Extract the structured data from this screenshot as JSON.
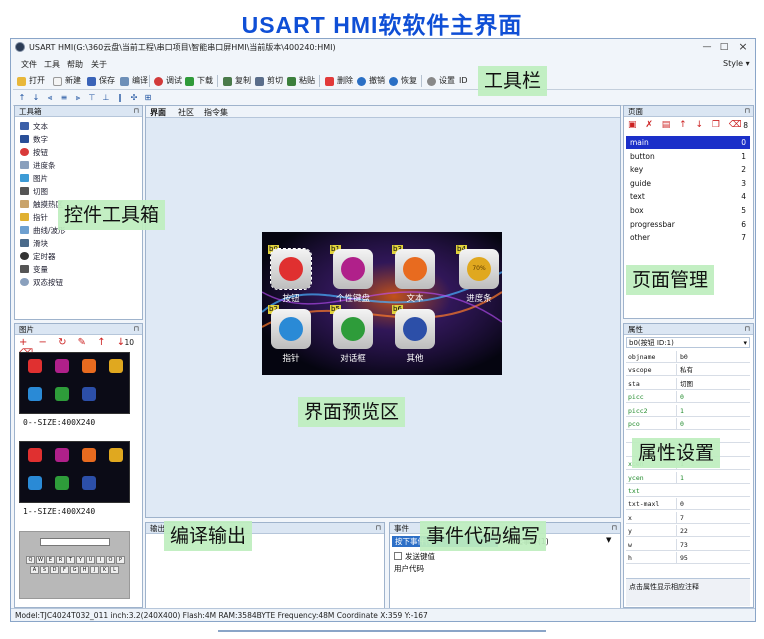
{
  "banner": {
    "title": "USART HMI软软件主界面"
  },
  "window": {
    "title": "USART HMI(G:\\360云盘\\当前工程\\串口项目\\智能串口屏HMI\\当前版本\\400240:HMI)",
    "min": "—",
    "max": "□",
    "close": "×"
  },
  "menubar": {
    "items": [
      "文件",
      "工具",
      "帮助",
      "关于"
    ],
    "style": "Style ▾"
  },
  "toolbar": {
    "open": "打开",
    "new": "新建",
    "save": "保存",
    "compile": "编译",
    "debug": "调试",
    "download": "下载",
    "copy": "复制",
    "cut": "剪切",
    "paste": "粘贴",
    "delete": "删除",
    "undo": "撤销",
    "redo": "恢复",
    "settings": "设置",
    "id": "ID"
  },
  "toolbox": {
    "title": "工具箱",
    "items": [
      "文本",
      "数字",
      "按钮",
      "进度条",
      "图片",
      "切图",
      "触摸热区",
      "指针",
      "曲线/波形",
      "滑块",
      "定时器",
      "变量",
      "双态按钮"
    ]
  },
  "pictures": {
    "title": "图片",
    "count": "10",
    "items": [
      {
        "caption": "0--SIZE:400X240"
      },
      {
        "caption": "1--SIZE:400X240"
      }
    ],
    "tabs": [
      "图片",
      "字库"
    ]
  },
  "center": {
    "tabs": [
      "界面",
      "社区",
      "指令集"
    ],
    "preview": {
      "buttons": [
        {
          "tag": "b0",
          "label": "按钮",
          "color": "#e03030"
        },
        {
          "tag": "b1",
          "label": "个性键盘",
          "color": "#b0208a"
        },
        {
          "tag": "b3",
          "label": "文本",
          "color": "#e86b1f"
        },
        {
          "tag": "b4",
          "label": "进度条",
          "color": "#e0a81f",
          "inner": "70%"
        },
        {
          "tag": "b2",
          "label": "指针",
          "color": "#2a8ad6"
        },
        {
          "tag": "b5",
          "label": "对话框",
          "color": "#2e9c3a"
        },
        {
          "tag": "b6",
          "label": "其他",
          "color": "#2c4fa8"
        }
      ]
    }
  },
  "output": {
    "title": "输出"
  },
  "events": {
    "title": "事件",
    "tab_press": "按下事件(0)",
    "tab_release": "弹起事件(1)",
    "checkbox": "发送键值",
    "user_code": "用户代码"
  },
  "pages": {
    "title": "页面",
    "count": "8",
    "items": [
      {
        "name": "main",
        "id": "0"
      },
      {
        "name": "button",
        "id": "1"
      },
      {
        "name": "key",
        "id": "2"
      },
      {
        "name": "guide",
        "id": "3"
      },
      {
        "name": "text",
        "id": "4"
      },
      {
        "name": "box",
        "id": "5"
      },
      {
        "name": "progressbar",
        "id": "6"
      },
      {
        "name": "other",
        "id": "7"
      }
    ]
  },
  "properties": {
    "title": "属性",
    "selected": "b0(按钮 ID:1)",
    "rows": [
      {
        "k": "objname",
        "v": "b0"
      },
      {
        "k": "vscope",
        "v": "私有"
      },
      {
        "k": "sta",
        "v": "切图"
      },
      {
        "k": "picc",
        "v": "0"
      },
      {
        "k": "picc2",
        "v": "1"
      },
      {
        "k": "pco",
        "v": "0"
      },
      {
        "k": "",
        "v": ""
      },
      {
        "k": "",
        "v": ""
      },
      {
        "k": "xcen",
        "v": "1"
      },
      {
        "k": "ycen",
        "v": "1"
      },
      {
        "k": "txt",
        "v": ""
      },
      {
        "k": "txt-maxl",
        "v": "0"
      },
      {
        "k": "x",
        "v": "7"
      },
      {
        "k": "y",
        "v": "22"
      },
      {
        "k": "w",
        "v": "73"
      },
      {
        "k": "h",
        "v": "95"
      }
    ],
    "hint": "点击属性显示相应注释"
  },
  "statusbar": {
    "text": "Model:TJC4024T032_011   inch:3.2(240X400)  Flash:4M  RAM:3584BYTE  Frequency:48M      Coordinate X:359  Y:-167"
  },
  "callouts": {
    "toolbar": "工具栏",
    "toolbox": "控件工具箱",
    "pages": "页面管理",
    "preview": "界面预览区",
    "props": "属性设置",
    "output": "编译输出",
    "events": "事件代码编写"
  }
}
